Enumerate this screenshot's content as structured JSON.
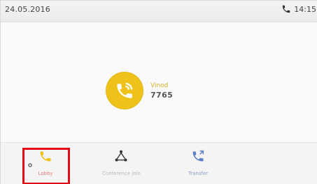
{
  "status_bar": {
    "date": "24.05.2016",
    "time": "14:15",
    "icon": "phone-icon"
  },
  "call": {
    "label": "Vinod",
    "number": "7765",
    "avatar_color": "#efc21a",
    "avatar_icon": "call-in-progress-icon"
  },
  "softkeys": [
    {
      "label": "Lobby",
      "icon": "phone-yellow-icon",
      "color": "#efc21a"
    },
    {
      "label": "Conference join",
      "icon": "conference-icon",
      "color": "#444444"
    },
    {
      "label": "Transfer",
      "icon": "phone-transfer-icon",
      "color": "#5a7fc7"
    }
  ],
  "accent_highlight": "#e10b17"
}
